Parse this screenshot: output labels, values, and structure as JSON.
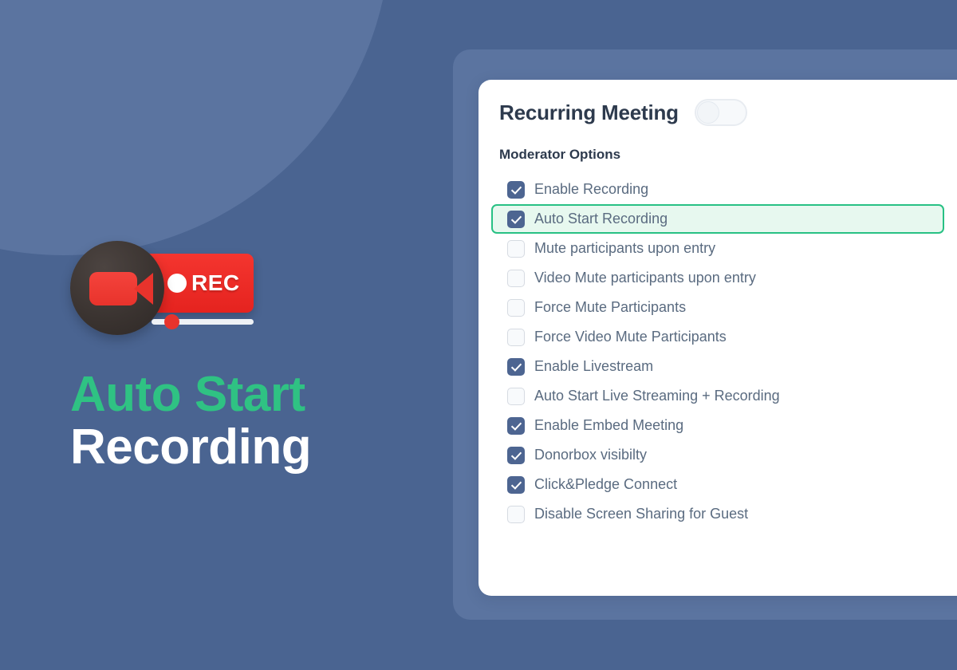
{
  "promo": {
    "logo": {
      "icon_name": "video-camera-rec-logo",
      "badge_text": "REC"
    },
    "title_line1": "Auto Start",
    "title_line2": "Recording",
    "accent_color": "#2fc283",
    "background_color": "#4a6491"
  },
  "card": {
    "title": "Recurring Meeting",
    "toggle": {
      "state": "off",
      "name": "recurring-meeting-toggle"
    },
    "section_label": "Moderator Options",
    "highlight_color": "#28c184",
    "highlight_fill": "#e7f8ef",
    "checkbox_checked_color": "#4d6591",
    "options": [
      {
        "label": "Enable Recording",
        "checked": true,
        "highlighted": false
      },
      {
        "label": "Auto Start Recording",
        "checked": true,
        "highlighted": true
      },
      {
        "label": "Mute participants upon entry",
        "checked": false,
        "highlighted": false
      },
      {
        "label": "Video Mute participants upon entry",
        "checked": false,
        "highlighted": false
      },
      {
        "label": "Force Mute Participants",
        "checked": false,
        "highlighted": false
      },
      {
        "label": "Force Video Mute Participants",
        "checked": false,
        "highlighted": false
      },
      {
        "label": "Enable Livestream",
        "checked": true,
        "highlighted": false
      },
      {
        "label": "Auto Start Live Streaming + Recording",
        "checked": false,
        "highlighted": false
      },
      {
        "label": "Enable Embed Meeting",
        "checked": true,
        "highlighted": false
      },
      {
        "label": "Donorbox visibilty",
        "checked": true,
        "highlighted": false
      },
      {
        "label": "Click&Pledge Connect",
        "checked": true,
        "highlighted": false
      },
      {
        "label": "Disable Screen Sharing for Guest",
        "checked": false,
        "highlighted": false
      }
    ]
  }
}
